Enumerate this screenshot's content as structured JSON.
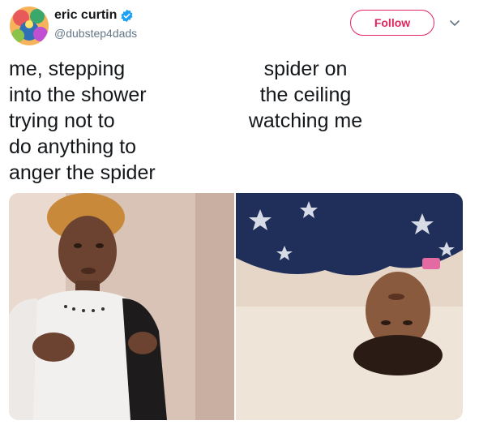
{
  "user": {
    "display_name": "eric curtin",
    "handle": "@dubstep4dads",
    "verified": true
  },
  "follow_button_label": "Follow",
  "caption_left": "me, stepping\ninto the shower\ntrying not to\ndo anything to\nanger the spider",
  "caption_right": "spider on\nthe ceiling\nwatching me",
  "icons": {
    "verified": "verified-badge-icon",
    "menu": "chevron-down-icon"
  },
  "colors": {
    "accent": "#e0245e",
    "verified": "#1da1f2",
    "text": "#14171a",
    "secondary_text": "#657786"
  }
}
